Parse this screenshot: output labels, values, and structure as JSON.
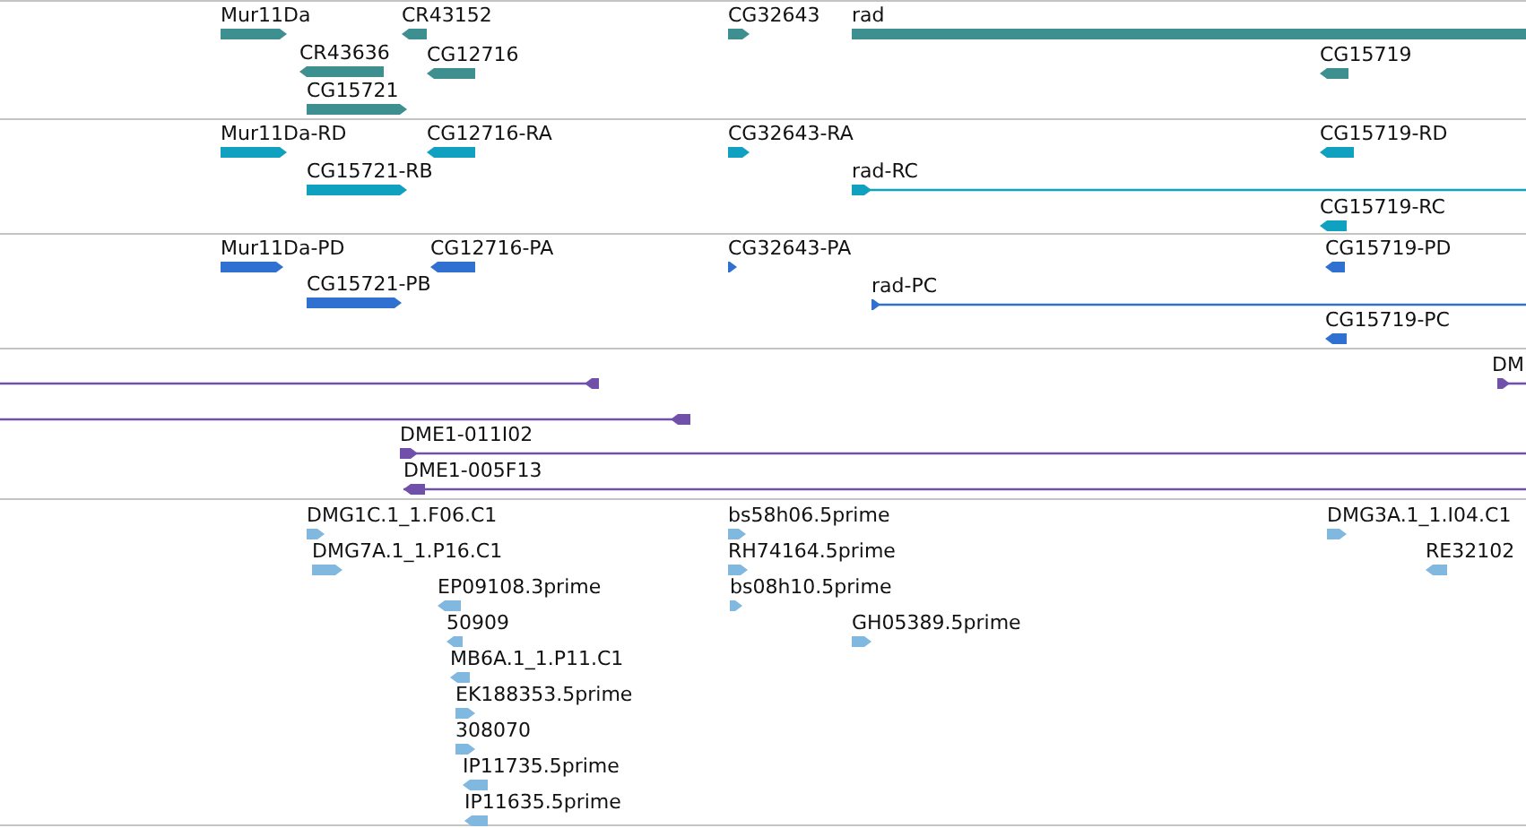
{
  "tracks": [
    {
      "color": "#3d8f90",
      "features": [
        {
          "label": "Mur11Da",
          "reverse": false,
          "kind": "block"
        },
        {
          "label": "CR43152",
          "reverse": true,
          "kind": "block"
        },
        {
          "label": "CR43636",
          "reverse": true,
          "kind": "block"
        },
        {
          "label": "CG12716",
          "reverse": true,
          "kind": "block"
        },
        {
          "label": "CG15721",
          "reverse": false,
          "kind": "block"
        },
        {
          "label": "CG32643",
          "reverse": false,
          "kind": "block"
        },
        {
          "label": "rad",
          "reverse": false,
          "kind": "block"
        },
        {
          "label": "CG15719",
          "reverse": true,
          "kind": "block"
        }
      ]
    },
    {
      "color": "#10a0c0",
      "features": [
        {
          "label": "Mur11Da-RD",
          "reverse": false,
          "kind": "block"
        },
        {
          "label": "CG12716-RA",
          "reverse": true,
          "kind": "block"
        },
        {
          "label": "CG15721-RB",
          "reverse": false,
          "kind": "block"
        },
        {
          "label": "CG32643-RA",
          "reverse": false,
          "kind": "block"
        },
        {
          "label": "rad-RC",
          "reverse": false,
          "kind": "line"
        },
        {
          "label": "CG15719-RD",
          "reverse": true,
          "kind": "block"
        },
        {
          "label": "CG15719-RC",
          "reverse": true,
          "kind": "block"
        }
      ]
    },
    {
      "color": "#3070d0",
      "features": [
        {
          "label": "Mur11Da-PD",
          "reverse": false,
          "kind": "block"
        },
        {
          "label": "CG12716-PA",
          "reverse": true,
          "kind": "block"
        },
        {
          "label": "CG15721-PB",
          "reverse": false,
          "kind": "block"
        },
        {
          "label": "CG32643-PA",
          "reverse": false,
          "kind": "block"
        },
        {
          "label": "rad-PC",
          "reverse": false,
          "kind": "line"
        },
        {
          "label": "CG15719-PD",
          "reverse": true,
          "kind": "block"
        },
        {
          "label": "CG15719-PC",
          "reverse": true,
          "kind": "block"
        }
      ]
    },
    {
      "color": "#7050a8",
      "features": [
        {
          "reverse": true,
          "kind": "line"
        },
        {
          "label": "DM",
          "reverse": false,
          "kind": "line"
        },
        {
          "reverse": true,
          "kind": "line"
        },
        {
          "label": "DME1-011I02",
          "reverse": false,
          "kind": "line"
        },
        {
          "label": "DME1-005F13",
          "reverse": true,
          "kind": "line"
        }
      ]
    },
    {
      "color": "#80b8e0",
      "features": [
        {
          "label": "DMG1C.1_1.F06.C1",
          "reverse": false,
          "kind": "block"
        },
        {
          "label": "DMG7A.1_1.P16.C1",
          "reverse": false,
          "kind": "block"
        },
        {
          "label": "EP09108.3prime",
          "reverse": true,
          "kind": "block"
        },
        {
          "label": "50909",
          "reverse": true,
          "kind": "block"
        },
        {
          "label": "MB6A.1_1.P11.C1",
          "reverse": true,
          "kind": "block"
        },
        {
          "label": "EK188353.5prime",
          "reverse": false,
          "kind": "block"
        },
        {
          "label": "308070",
          "reverse": false,
          "kind": "block"
        },
        {
          "label": "IP11735.5prime",
          "reverse": true,
          "kind": "block"
        },
        {
          "label": "IP11635.5prime",
          "reverse": true,
          "kind": "block"
        },
        {
          "label": "bs58h06.5prime",
          "reverse": false,
          "kind": "block"
        },
        {
          "label": "RH74164.5prime",
          "reverse": false,
          "kind": "block"
        },
        {
          "label": "bs08h10.5prime",
          "reverse": false,
          "kind": "block"
        },
        {
          "label": "GH05389.5prime",
          "reverse": false,
          "kind": "block"
        },
        {
          "label": "DMG3A.1_1.I04.C1",
          "reverse": false,
          "kind": "block"
        },
        {
          "label": "RE32102",
          "reverse": true,
          "kind": "block"
        }
      ]
    }
  ]
}
